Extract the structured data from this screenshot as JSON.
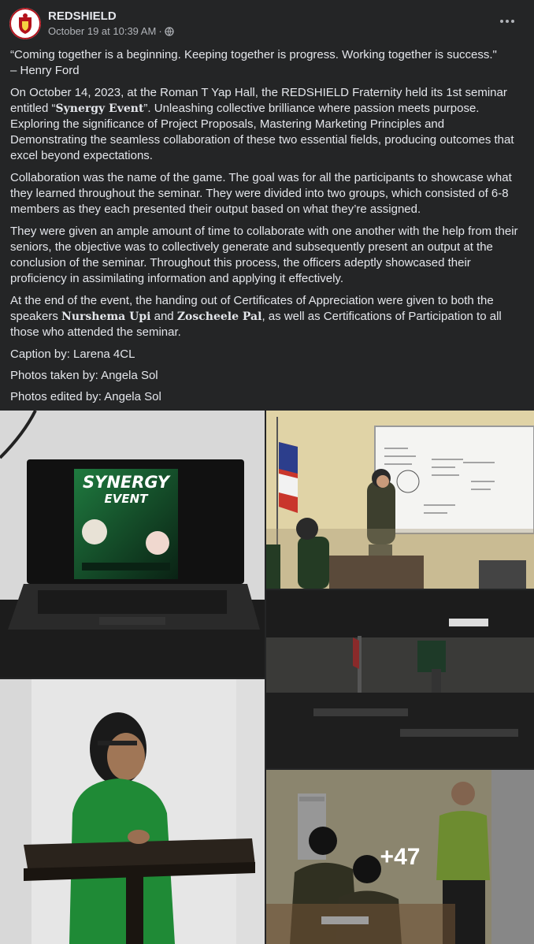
{
  "post": {
    "page_name": "REDSHIELD",
    "timestamp": "October 19 at 10:39 AM",
    "separator": "·",
    "audience_icon": "globe-icon",
    "more_icon": "more-horizontal-icon"
  },
  "content": {
    "quote": "“Coming together is a beginning. Keeping together is progress. Working together is success.\"",
    "quote_author": " – Henry Ford",
    "p1_a": "On October 14, 2023, at the Roman T Yap Hall, the REDSHIELD Fraternity held its 1st seminar entitled “",
    "p1_bold": "Synergy Event",
    "p1_b": "”. Unleashing collective brilliance where passion meets purpose. Exploring the significance of Project Proposals, Mastering Marketing Principles and Demonstrating the seamless collaboration of these two essential fields, producing outcomes that excel beyond expectations.",
    "p2": "Collaboration was the name of the game. The goal was for all the participants to showcase what they learned throughout the seminar. They were divided into two groups, which consisted of 6-8 members as they each presented their output based on what they’re assigned.",
    "p3": "They were given an ample amount of time to collaborate with one another with the help from their seniors, the objective was to collectively generate and subsequently present an output at the conclusion of the seminar. Throughout this process, the officers adeptly showcased their proficiency in assimilating information and applying it effectively.",
    "p4_a": "At the end of the event, the handing out of Certificates of Appreciation were given to both the speakers ",
    "p4_bold1": "Nurshema Upi",
    "p4_and": " and ",
    "p4_bold2": "Zoscheele Pal",
    "p4_b": ", as well as Certifications of Participation to all those who attended the seminar.",
    "caption": "Caption by: Larena 4CL",
    "photos_taken": "Photos taken by: Angela Sol",
    "photos_edited": "Photos edited by: Angela Sol"
  },
  "gallery": {
    "laptop_title": "SYNERGY",
    "laptop_subtitle": "EVENT",
    "more_count": "+47"
  },
  "colors": {
    "background": "#242526",
    "text": "#e4e6eb",
    "secondary": "#b0b3b8",
    "brand_red": "#b3121b"
  }
}
